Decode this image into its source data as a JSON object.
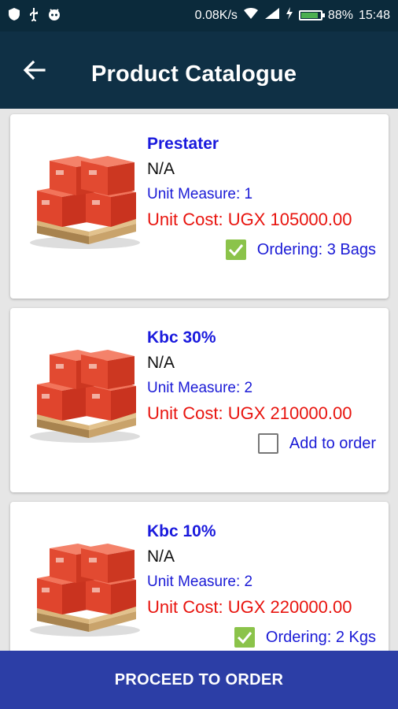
{
  "status": {
    "speed": "0.08K/s",
    "battery": "88%",
    "time": "15:48",
    "battery_level": 0.88
  },
  "header": {
    "title": "Product Catalogue"
  },
  "products": [
    {
      "name": "Prestater",
      "description": "N/A",
      "unit_measure": "Unit Measure: 1",
      "unit_cost": "Unit Cost: UGX 105000.00",
      "checked": true,
      "order_label": "Ordering: 3 Bags"
    },
    {
      "name": "Kbc 30%",
      "description": "N/A",
      "unit_measure": "Unit Measure: 2",
      "unit_cost": "Unit Cost: UGX 210000.00",
      "checked": false,
      "order_label": "Add to order"
    },
    {
      "name": "Kbc 10%",
      "description": "N/A",
      "unit_measure": "Unit Measure: 2",
      "unit_cost": "Unit Cost: UGX 220000.00",
      "checked": true,
      "order_label": "Ordering: 2 Kgs"
    }
  ],
  "footer": {
    "proceed_label": "PROCEED TO ORDER"
  },
  "colors": {
    "accent": "#2c3ea6",
    "appbar": "#0f3045",
    "cost": "#e8140e",
    "check": "#8bc34a"
  }
}
